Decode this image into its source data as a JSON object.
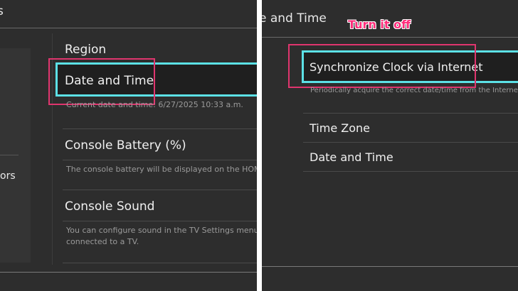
{
  "left": {
    "title_partial": "s",
    "sidebar_partial": "ors",
    "items": [
      {
        "label": "Region"
      },
      {
        "label": "Date and Time",
        "desc": "Current date and time: 6/27/2025 10:33 a.m."
      },
      {
        "label": "Console Battery (%)",
        "desc": "The console battery will be displayed on the HOM"
      },
      {
        "label": "Console Sound",
        "desc_line1": "You can configure sound in the TV Settings menu",
        "desc_line2": "connected to a TV."
      }
    ]
  },
  "right": {
    "title_partial": "e and Time",
    "annotation": "Turn it off",
    "items": [
      {
        "label": "Synchronize Clock via Internet",
        "desc": "Periodically acquire the correct date/time from the Interne"
      },
      {
        "label": "Time Zone"
      },
      {
        "label": "Date and Time"
      }
    ]
  },
  "colors": {
    "highlight": "#5ce1e6",
    "annotation_box": "#e0356e",
    "annotation_text": "#ff2d7a",
    "background": "#2d2d2d"
  }
}
